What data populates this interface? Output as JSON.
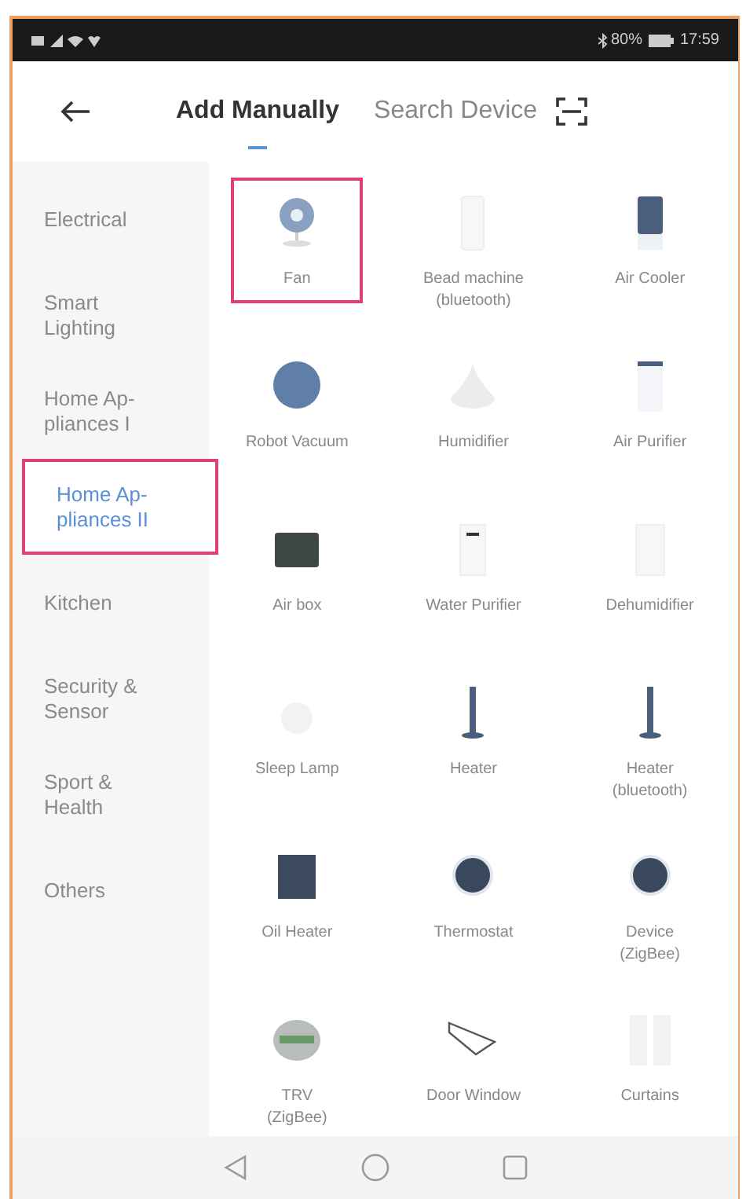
{
  "status_bar": {
    "battery": "80%",
    "time": "17:59"
  },
  "tabs": [
    {
      "label": "Add Manually",
      "selected": true
    },
    {
      "label": "Search Device",
      "selected": false
    }
  ],
  "categories": [
    {
      "label": "Electrical",
      "selected": false,
      "highlighted": false
    },
    {
      "label": "Smart Lighting",
      "selected": false,
      "highlighted": false
    },
    {
      "label": "Home Ap-\npliances I",
      "selected": false,
      "highlighted": false
    },
    {
      "label": "Home Ap-\npliances II",
      "selected": true,
      "highlighted": true
    },
    {
      "label": "Kitchen",
      "selected": false,
      "highlighted": false
    },
    {
      "label": "Security &\nSensor",
      "selected": false,
      "highlighted": false
    },
    {
      "label": "Sport &\nHealth",
      "selected": false,
      "highlighted": false
    },
    {
      "label": "Others",
      "selected": false,
      "highlighted": false
    }
  ],
  "devices": [
    {
      "label": "Fan",
      "highlighted": true
    },
    {
      "label": "Bead machine\n(bluetooth)",
      "highlighted": false
    },
    {
      "label": "Air Cooler",
      "highlighted": false
    },
    {
      "label": "Robot Vacuum",
      "highlighted": false
    },
    {
      "label": "Humidifier",
      "highlighted": false
    },
    {
      "label": "Air Purifier",
      "highlighted": false
    },
    {
      "label": "Air box",
      "highlighted": false
    },
    {
      "label": "Water Purifier",
      "highlighted": false
    },
    {
      "label": "Dehumidifier",
      "highlighted": false
    },
    {
      "label": "Sleep Lamp",
      "highlighted": false
    },
    {
      "label": "Heater",
      "highlighted": false
    },
    {
      "label": "Heater\n(bluetooth)",
      "highlighted": false
    },
    {
      "label": "Oil Heater",
      "highlighted": false
    },
    {
      "label": "Thermostat",
      "highlighted": false
    },
    {
      "label": "Device\n(ZigBee)",
      "highlighted": false
    },
    {
      "label": "TRV\n(ZigBee)",
      "highlighted": false
    },
    {
      "label": "Door Window",
      "highlighted": false
    },
    {
      "label": "Curtains",
      "highlighted": false
    }
  ]
}
